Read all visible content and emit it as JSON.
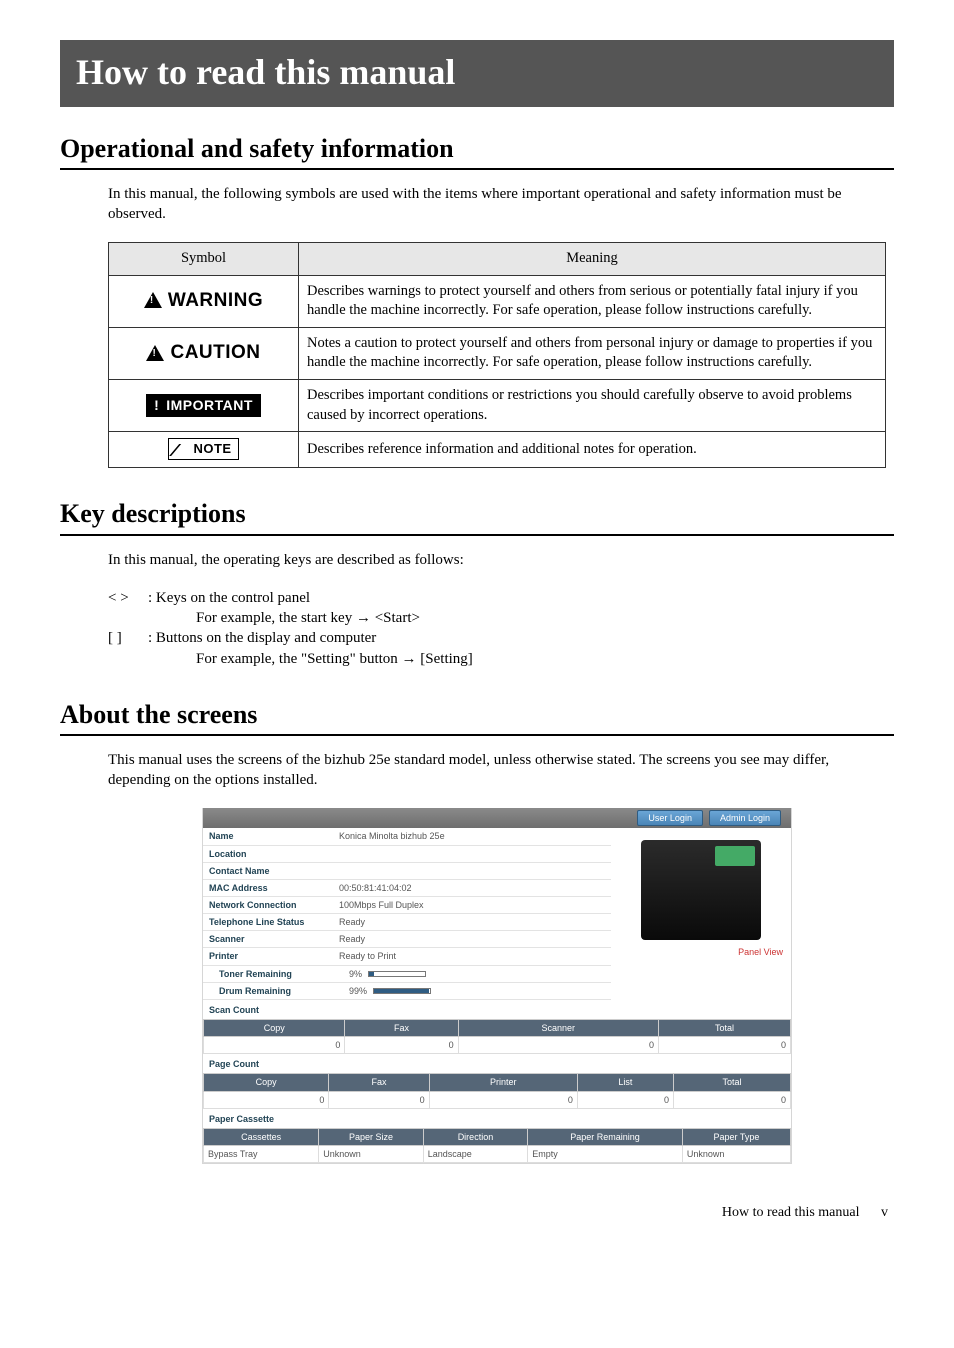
{
  "page": {
    "title": "How to read this manual",
    "footer": "How to read this manual",
    "page_number": "v"
  },
  "sections": {
    "operational": {
      "heading": "Operational and safety information",
      "intro": "In this manual, the following symbols are used with the items where important operational and safety information must be observed.",
      "table": {
        "col_symbol": "Symbol",
        "col_meaning": "Meaning",
        "rows": {
          "warning": {
            "label": "WARNING",
            "meaning": "Describes warnings to protect yourself and others from serious or potentially fatal injury if you handle the machine incorrectly. For safe operation, please follow instructions carefully."
          },
          "caution": {
            "label": "CAUTION",
            "meaning": "Notes a caution to protect yourself and others from personal injury or damage to properties if you handle the machine incorrectly. For safe operation, please follow instructions carefully."
          },
          "important": {
            "label": "IMPORTANT",
            "meaning": "Describes important conditions or restrictions you should carefully observe to avoid problems caused by incorrect operations."
          },
          "note": {
            "label": "NOTE",
            "meaning": "Describes reference information and additional notes for operation."
          }
        }
      }
    },
    "keys": {
      "heading": "Key descriptions",
      "intro": "In this manual, the operating keys are described as follows:",
      "item1": {
        "sym": "<   >",
        "desc": ": Keys on the control panel",
        "example": "For example, the start key → <Start>"
      },
      "item2": {
        "sym": "[    ]",
        "desc": ": Buttons on the display and computer",
        "example": "For example, the \"Setting\" button → [Setting]"
      }
    },
    "screens": {
      "heading": "About the screens",
      "intro": "This manual uses the screens of the bizhub 25e standard model, unless otherwise stated. The screens you see may differ, depending on the options installed."
    }
  },
  "screenshot": {
    "buttons": {
      "user_login": "User Login",
      "admin_login": "Admin Login"
    },
    "panel_view": "Panel View",
    "info": {
      "name_label": "Name",
      "name_val": "Konica Minolta bizhub 25e",
      "location_label": "Location",
      "location_val": "",
      "contact_label": "Contact Name",
      "contact_val": "",
      "mac_label": "MAC Address",
      "mac_val": "00:50:81:41:04:02",
      "net_label": "Network Connection",
      "net_val": "100Mbps    Full Duplex",
      "tel_label": "Telephone Line Status",
      "tel_val": "Ready",
      "scanner_label": "Scanner",
      "scanner_val": "Ready",
      "printer_label": "Printer",
      "printer_val": "Ready to Print",
      "toner_label": "Toner Remaining",
      "toner_val": "9%",
      "drum_label": "Drum Remaining",
      "drum_val": "99%"
    },
    "scan_count": {
      "label": "Scan Count",
      "headers": {
        "copy": "Copy",
        "fax": "Fax",
        "scanner": "Scanner",
        "total": "Total"
      },
      "values": {
        "copy": "0",
        "fax": "0",
        "scanner": "0",
        "total": "0"
      }
    },
    "page_count": {
      "label": "Page Count",
      "headers": {
        "copy": "Copy",
        "fax": "Fax",
        "printer": "Printer",
        "list": "List",
        "total": "Total"
      },
      "values": {
        "copy": "0",
        "fax": "0",
        "printer": "0",
        "list": "0",
        "total": "0"
      }
    },
    "paper": {
      "label": "Paper Cassette",
      "headers": {
        "cassettes": "Cassettes",
        "size": "Paper Size",
        "direction": "Direction",
        "remaining": "Paper Remaining",
        "type": "Paper Type"
      },
      "row1": {
        "cassettes": "Bypass Tray",
        "size": "Unknown",
        "direction": "Landscape",
        "remaining": "Empty",
        "type": "Unknown"
      }
    }
  }
}
